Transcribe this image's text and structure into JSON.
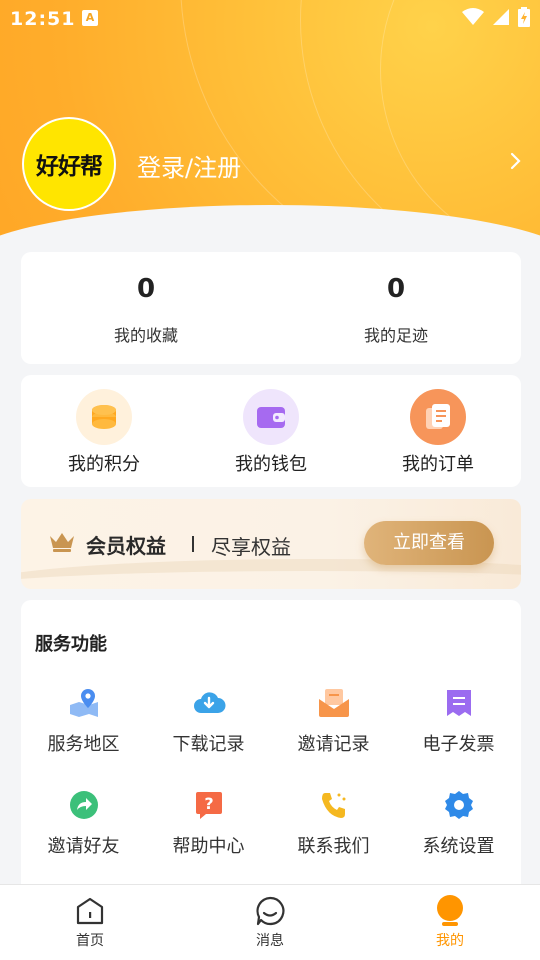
{
  "status_bar": {
    "time": "12:51",
    "notification_icon": "A"
  },
  "profile": {
    "avatar_text": "好好帮",
    "login_label": "登录/注册"
  },
  "stats": [
    {
      "value": "0",
      "label": "我的收藏"
    },
    {
      "value": "0",
      "label": "我的足迹"
    }
  ],
  "quick_actions": [
    {
      "label": "我的积分",
      "icon": "coins-icon",
      "color": "#ffa820"
    },
    {
      "label": "我的钱包",
      "icon": "wallet-icon",
      "color": "#a66af0"
    },
    {
      "label": "我的订单",
      "icon": "order-icon",
      "color": "#f7955a"
    }
  ],
  "vip_banner": {
    "title": "会员权益",
    "subtitle": "尽享权益",
    "button": "立即查看"
  },
  "services": {
    "heading": "服务功能",
    "items": [
      {
        "label": "服务地区",
        "icon": "map-pin-icon",
        "color": "#4a8df0"
      },
      {
        "label": "下载记录",
        "icon": "cloud-download-icon",
        "color": "#3ba3e8"
      },
      {
        "label": "邀请记录",
        "icon": "mail-icon",
        "color": "#f7954a"
      },
      {
        "label": "电子发票",
        "icon": "invoice-icon",
        "color": "#9b6cf0"
      },
      {
        "label": "邀请好友",
        "icon": "share-icon",
        "color": "#3cc07a"
      },
      {
        "label": "帮助中心",
        "icon": "help-icon",
        "color": "#f56a45"
      },
      {
        "label": "联系我们",
        "icon": "phone-icon",
        "color": "#f5b820"
      },
      {
        "label": "系统设置",
        "icon": "gear-icon",
        "color": "#2f8ae8"
      }
    ]
  },
  "tabbar": [
    {
      "label": "首页",
      "icon": "home-icon",
      "active": false
    },
    {
      "label": "消息",
      "icon": "message-icon",
      "active": false
    },
    {
      "label": "我的",
      "icon": "profile-icon",
      "active": true
    }
  ],
  "colors": {
    "accent": "#ff9500",
    "hero": "#ffb22e",
    "vip_gold": "#c99551"
  }
}
